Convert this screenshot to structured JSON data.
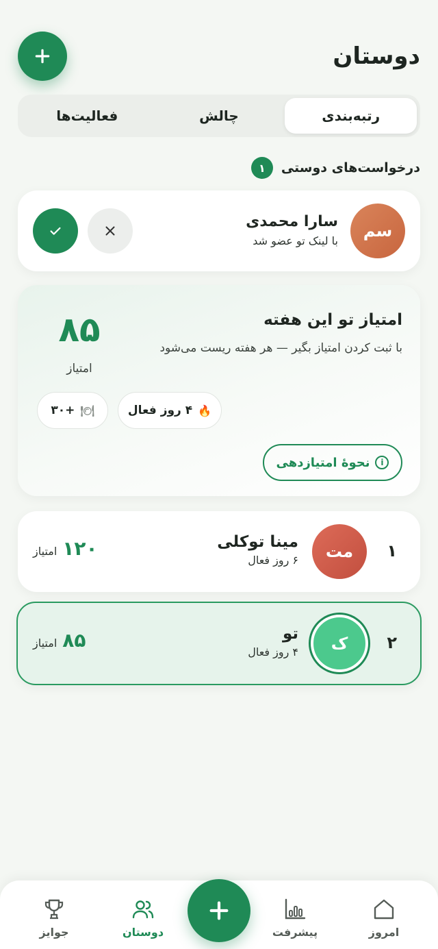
{
  "header": {
    "title": "دوستان"
  },
  "tabs": [
    {
      "label": "رتبه‌بندی",
      "active": true
    },
    {
      "label": "چالش",
      "active": false
    },
    {
      "label": "فعالیت‌ها",
      "active": false
    }
  ],
  "requests": {
    "label": "درخواست‌های دوستی",
    "count": "۱",
    "items": [
      {
        "initials": "سم",
        "name": "سارا محمدی",
        "subtitle": "با لینک تو عضو شد"
      }
    ]
  },
  "score_card": {
    "title": "امتیاز تو این هفته",
    "description": "با ثبت کردن امتیاز بگیر — هر هفته ریست می‌شود",
    "value": "۸۵",
    "unit": "امتیاز",
    "streak": "۴ روز فعال",
    "meals": "+۳۰",
    "how_label": "نحوهٔ امتیازدهی"
  },
  "leaderboard": [
    {
      "rank": "۱",
      "initials": "مت",
      "name": "مینا توکلی",
      "subtitle": "۶ روز فعال",
      "points": "۱۲۰",
      "unit": "امتیاز"
    },
    {
      "rank": "۲",
      "initials": "ک",
      "name": "تو",
      "subtitle": "۴ روز فعال",
      "points": "۸۵",
      "unit": "امتیاز"
    }
  ],
  "nav": {
    "today": "امروز",
    "progress": "پیشرفت",
    "friends": "دوستان",
    "prizes": "جوایز"
  },
  "colors": {
    "accent": "#1f8a56",
    "background": "#f4f7f3"
  }
}
